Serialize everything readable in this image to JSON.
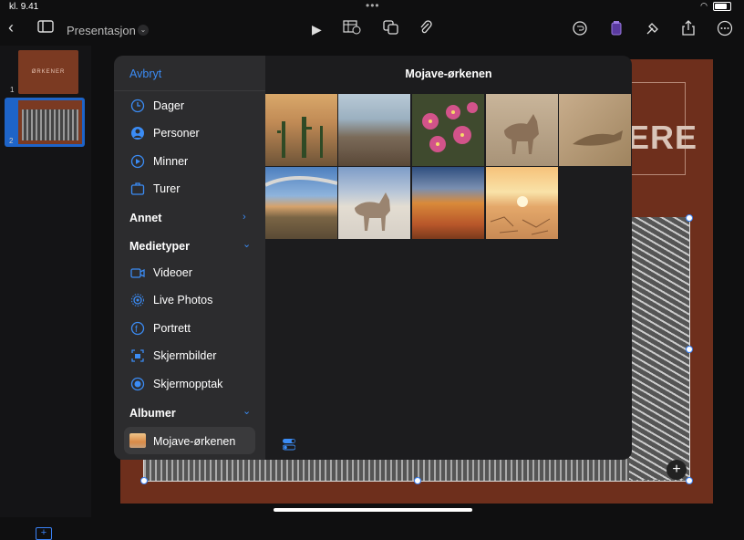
{
  "status": {
    "time": "kl. 9.41"
  },
  "toolbar": {
    "title": "Presentasjon",
    "icons": [
      "back-chevron-icon",
      "sidebar-icon",
      "play-icon",
      "table-icon",
      "shapes-icon",
      "paperclip-icon",
      "undo-icon",
      "format-icon",
      "brush-icon",
      "share-icon",
      "more-icon"
    ]
  },
  "slides": [
    {
      "number": "1",
      "text": "ØRKENER"
    },
    {
      "number": "2"
    }
  ],
  "slide": {
    "title_fragment": "ERE"
  },
  "picker": {
    "cancel": "Avbryt",
    "album_title": "Mojave-ørkenen",
    "items_top": [
      {
        "label": "Dager",
        "icon": "clock-icon"
      },
      {
        "label": "Personer",
        "icon": "person-icon"
      },
      {
        "label": "Minner",
        "icon": "memories-icon"
      },
      {
        "label": "Turer",
        "icon": "suitcase-icon"
      }
    ],
    "sections": {
      "other": "Annet",
      "media_types": "Medietyper",
      "albums": "Albumer"
    },
    "media_items": [
      {
        "label": "Videoer",
        "icon": "video-icon"
      },
      {
        "label": "Live Photos",
        "icon": "live-photo-icon"
      },
      {
        "label": "Portrett",
        "icon": "portrait-icon"
      },
      {
        "label": "Skjermbilder",
        "icon": "screenshot-icon"
      },
      {
        "label": "Skjermopptak",
        "icon": "screen-recording-icon"
      }
    ],
    "album_item": "Mojave-ørkenen",
    "photos": [
      {
        "name": "saguaro-sunset-photo",
        "colors": [
          "#c9a06a",
          "#7a5a3a"
        ]
      },
      {
        "name": "valley-overlook-photo",
        "colors": [
          "#9fb7c9",
          "#6d5a48"
        ]
      },
      {
        "name": "cactus-flowers-photo",
        "colors": [
          "#c0486e",
          "#3f4a2e"
        ]
      },
      {
        "name": "coyote-rocks-photo",
        "colors": [
          "#b6a48c",
          "#8d7a64"
        ]
      },
      {
        "name": "lizard-photo",
        "colors": [
          "#b99b78",
          "#7d6346"
        ]
      },
      {
        "name": "desert-sky-photo",
        "colors": [
          "#6a9bd0",
          "#8a7657"
        ]
      },
      {
        "name": "coyote-salt-flat-photo",
        "colors": [
          "#a8b9d0",
          "#d9d6d0"
        ]
      },
      {
        "name": "orange-hills-photo",
        "colors": [
          "#3c5d8c",
          "#c86a2e"
        ]
      },
      {
        "name": "cracked-earth-sunset-photo",
        "colors": [
          "#f7c27a",
          "#c88a55"
        ]
      }
    ]
  }
}
